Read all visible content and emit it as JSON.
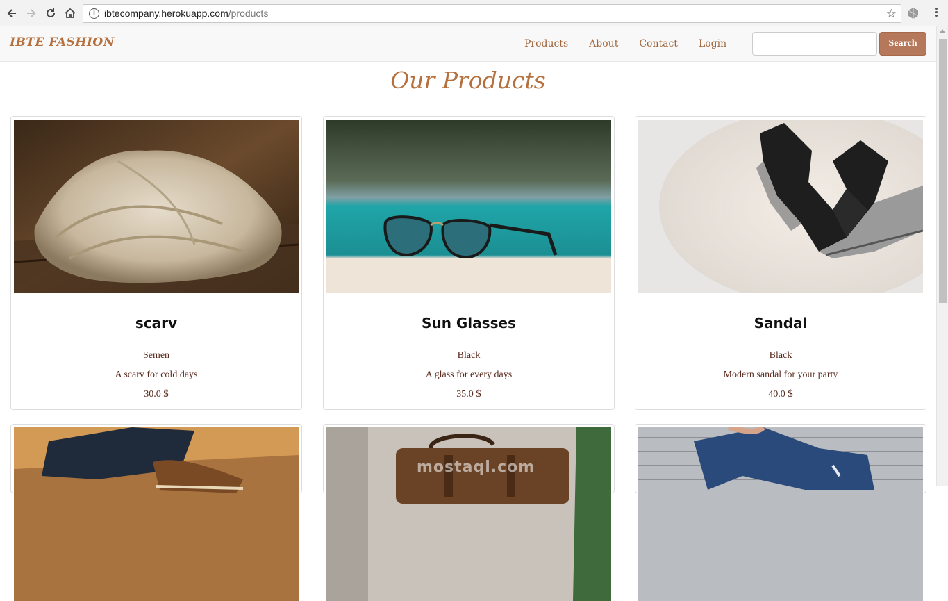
{
  "browser": {
    "url_host": "ibtecompany.herokuapp.com",
    "url_path": "/products"
  },
  "navbar": {
    "brand": "IBTE FASHION",
    "links": [
      "Products",
      "About",
      "Contact",
      "Login"
    ],
    "search_placeholder": "",
    "search_button": "Search"
  },
  "page": {
    "title": "Our Products"
  },
  "products": [
    {
      "name": "scarv",
      "color": "Semen",
      "description": "A scarv for cold days",
      "price": "30.0",
      "currency": "$"
    },
    {
      "name": "Sun Glasses",
      "color": "Black",
      "description": "A glass for every days",
      "price": "35.0",
      "currency": "$"
    },
    {
      "name": "Sandal",
      "color": "Black",
      "description": "Modern sandal for your party",
      "price": "40.0",
      "currency": "$"
    }
  ],
  "watermark": "mostaql.com",
  "colors": {
    "accent": "#b5703d",
    "button": "#b5785a",
    "text_detail": "#5a2a1c"
  }
}
